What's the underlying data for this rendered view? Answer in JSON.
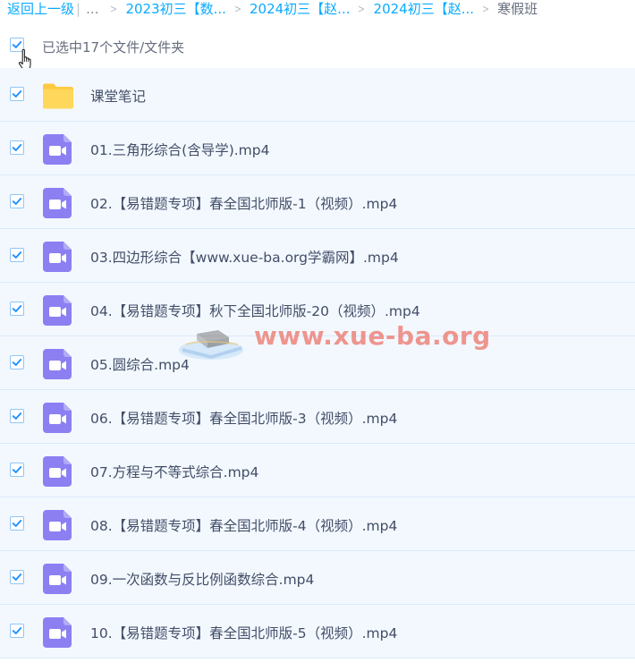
{
  "breadcrumb": {
    "back_label": "返回上一级",
    "separator": "|",
    "ellipsis": "...",
    "items": [
      "2023初三【数...",
      "2024初三【赵...",
      "2024初三【赵..."
    ],
    "current": "寒假班"
  },
  "selection": {
    "count_text": "已选中17个文件/文件夹",
    "checked": true
  },
  "files": [
    {
      "name": "课堂笔记",
      "type": "folder",
      "icon": "folder-icon"
    },
    {
      "name": "01.三角形综合(含导学).mp4",
      "type": "video",
      "icon": "video-file-icon"
    },
    {
      "name": "02.【易错题专项】春全国北师版-1（视频）.mp4",
      "type": "video",
      "icon": "video-file-icon"
    },
    {
      "name": "03.四边形综合【www.xue-ba.org学霸网】.mp4",
      "type": "video",
      "icon": "video-file-icon"
    },
    {
      "name": "04.【易错题专项】秋下全国北师版-20（视频）.mp4",
      "type": "video",
      "icon": "video-file-icon"
    },
    {
      "name": "05.圆综合.mp4",
      "type": "video",
      "icon": "video-file-icon"
    },
    {
      "name": "06.【易错题专项】春全国北师版-3（视频）.mp4",
      "type": "video",
      "icon": "video-file-icon"
    },
    {
      "name": "07.方程与不等式综合.mp4",
      "type": "video",
      "icon": "video-file-icon"
    },
    {
      "name": "08.【易错题专项】春全国北师版-4（视频）.mp4",
      "type": "video",
      "icon": "video-file-icon"
    },
    {
      "name": "09.一次函数与反比例函数综合.mp4",
      "type": "video",
      "icon": "video-file-icon"
    },
    {
      "name": "10.【易错题专项】春全国北师版-5（视频）.mp4",
      "type": "video",
      "icon": "video-file-icon"
    }
  ],
  "watermark": {
    "text": "www.xue-ba.org"
  },
  "colors": {
    "link": "#09aaff",
    "row_bg": "#f3f8ff",
    "check": "#1e90ff",
    "folder": "#ffd24d",
    "video": "#8c7ff2",
    "watermark": "#ec786e"
  }
}
